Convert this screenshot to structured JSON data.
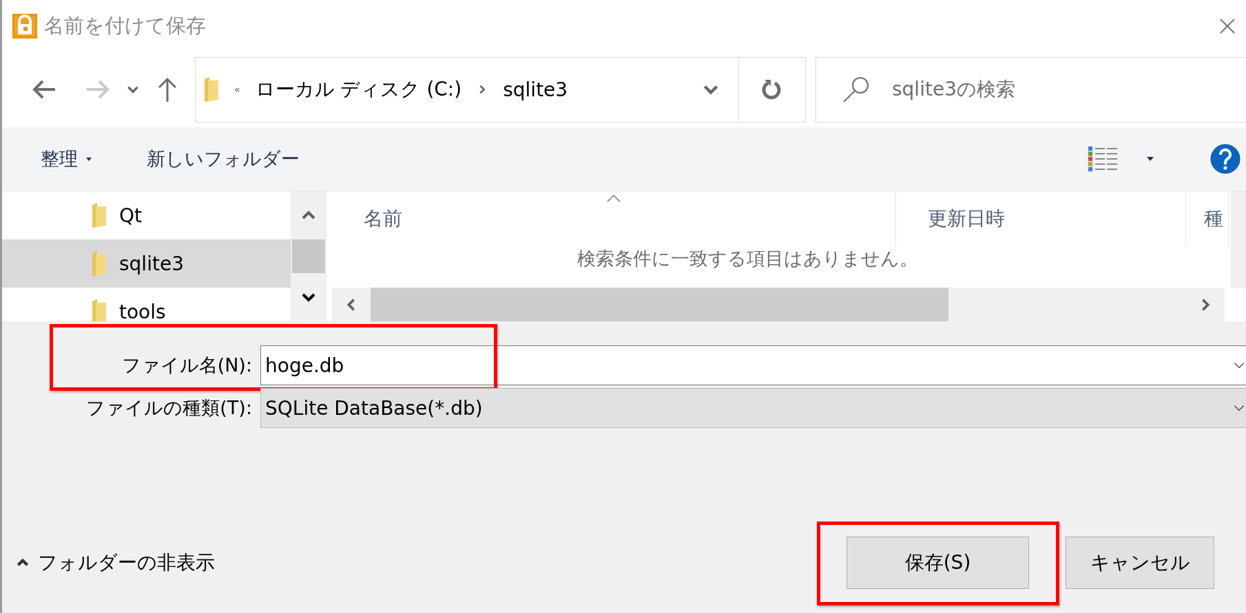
{
  "window": {
    "title": "名前を付けて保存"
  },
  "address": {
    "overflow": "«",
    "crumbs": [
      "ローカル ディスク (C:)",
      "sqlite3"
    ]
  },
  "search": {
    "placeholder": "sqlite3の検索"
  },
  "toolbar": {
    "organize": "整理",
    "new_folder": "新しいフォルダー"
  },
  "tree": {
    "items": [
      {
        "label": "Qt",
        "selected": false
      },
      {
        "label": "sqlite3",
        "selected": true
      },
      {
        "label": "tools",
        "selected": false
      }
    ]
  },
  "table": {
    "columns": [
      {
        "label": "名前",
        "sorted": true
      },
      {
        "label": "更新日時",
        "sorted": false
      },
      {
        "label": "種",
        "sorted": false
      }
    ],
    "empty_message": "検索条件に一致する項目はありません。"
  },
  "file_name": {
    "label": "ファイル名(N):",
    "value": "hoge.db",
    "highlighted": true
  },
  "file_type": {
    "label": "ファイルの種類(T):",
    "value": "SQLite DataBase(*.db)"
  },
  "hide_folders": "フォルダーの非表示",
  "buttons": [
    {
      "label": "保存(S)",
      "highlighted": true
    },
    {
      "label": "キャンセル",
      "highlighted": false
    }
  ]
}
